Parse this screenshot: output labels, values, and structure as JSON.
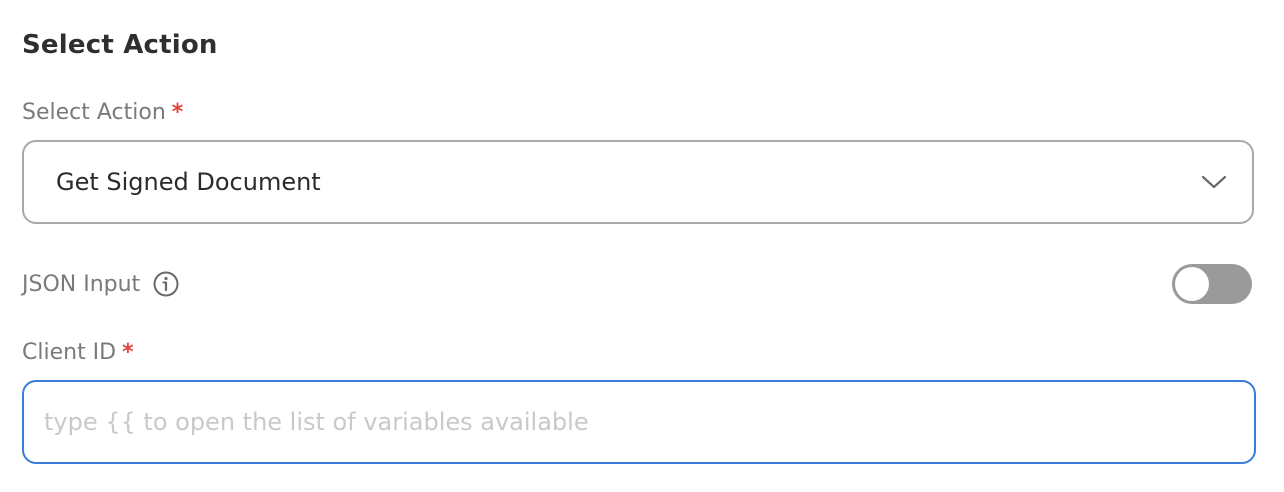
{
  "section": {
    "title": "Select Action"
  },
  "action_field": {
    "label": "Select Action",
    "required_mark": "*",
    "selected_value": "Get Signed Document",
    "icon": "chevron-down-icon"
  },
  "json_input": {
    "label": "JSON Input",
    "info_icon": "info-icon",
    "toggle_on": false
  },
  "client_id_field": {
    "label": "Client ID",
    "required_mark": "*",
    "value": "",
    "placeholder": "type {{ to open the list of variables available"
  },
  "colors": {
    "required": "#e0443e",
    "focus_border": "#3b7bdc",
    "toggle_off": "#9a9a9a"
  }
}
